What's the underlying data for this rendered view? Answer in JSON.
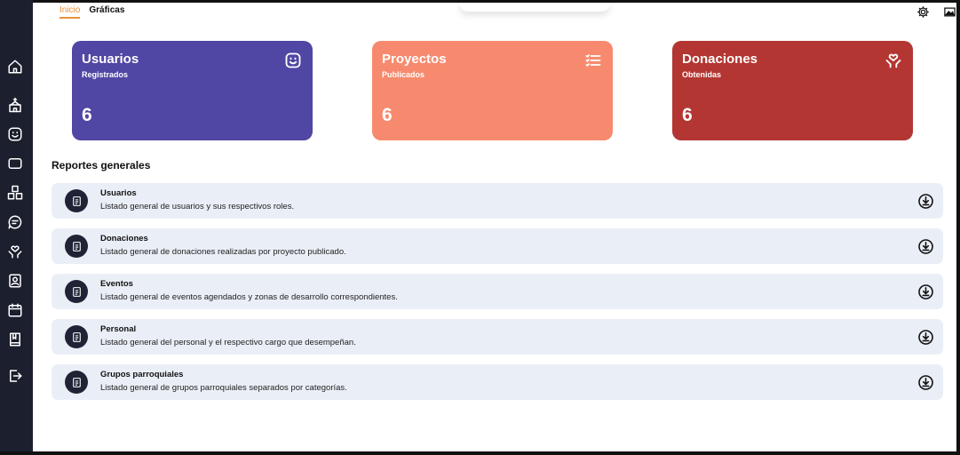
{
  "topnav": {
    "tabs": [
      {
        "label": "Inicio",
        "active": true
      },
      {
        "label": "Gráficas",
        "active": false
      }
    ],
    "icons": [
      "settings-icon",
      "image-icon"
    ]
  },
  "sidebar": {
    "icons": [
      "home-icon",
      "church-icon",
      "smile-icon",
      "rectangle-icon",
      "boxes-icon",
      "chat-icon",
      "heart-hands-icon",
      "contact-icon",
      "calendar-icon",
      "book-icon",
      "logout-icon"
    ]
  },
  "cards": [
    {
      "title": "Usuarios",
      "subtitle": "Registrados",
      "count": "6",
      "color": "#5046a3",
      "icon": "smile-icon"
    },
    {
      "title": "Proyectos",
      "subtitle": "Publicados",
      "count": "6",
      "color": "#f78a6e",
      "icon": "list-icon"
    },
    {
      "title": "Donaciones",
      "subtitle": "Obtenidas",
      "count": "6",
      "color": "#b33632",
      "icon": "heart-hands-icon"
    }
  ],
  "reports": {
    "title": "Reportes generales",
    "items": [
      {
        "title": "Usuarios",
        "description": "Listado general de usuarios y sus respectivos roles."
      },
      {
        "title": "Donaciones",
        "description": "Listado general de donaciones realizadas por proyecto publicado."
      },
      {
        "title": "Eventos",
        "description": "Listado general de eventos agendados y zonas de desarrollo correspondientes."
      },
      {
        "title": "Personal",
        "description": "Listado general del personal y el respectivo cargo que desempeñan."
      },
      {
        "title": "Grupos parroquiales",
        "description": "Listado general de grupos parroquiales separados por categorías."
      }
    ]
  }
}
